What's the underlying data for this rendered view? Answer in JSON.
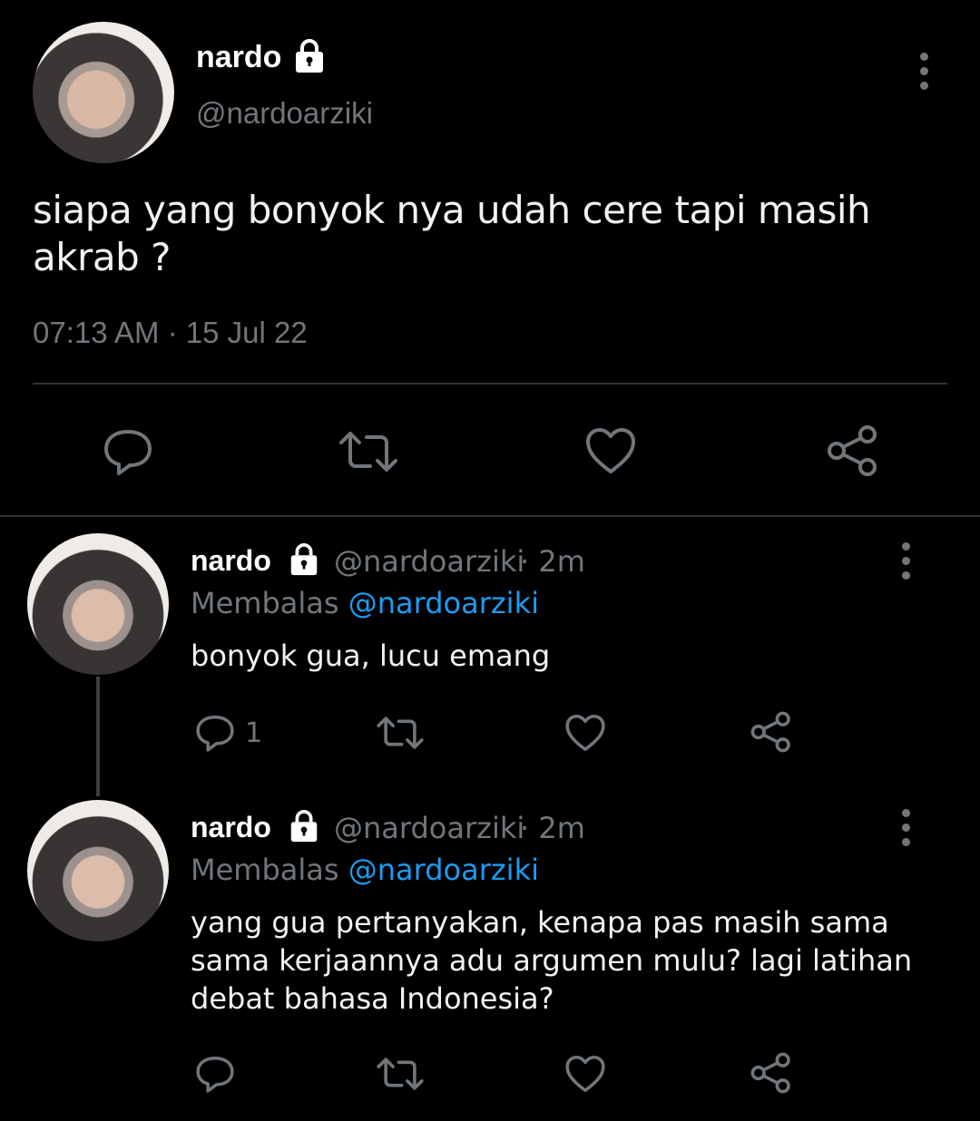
{
  "main_tweet": {
    "name": "nardo",
    "handle": "@nardoarziki",
    "text": "siapa yang bonyok nya udah cere tapi masih akrab ?",
    "timestamp": "07:13 AM · 15 Jul 22",
    "protected_icon": "lock-icon",
    "action_icons": [
      "reply-icon",
      "retweet-icon",
      "like-icon",
      "share-icon"
    ]
  },
  "replies": [
    {
      "name": "nardo",
      "handle": "@nardoarziki",
      "time_ago": "· 2m",
      "replying_label": "Membalas",
      "replying_to": "@nardoarziki",
      "text": "bonyok gua, lucu emang",
      "reply_count": "1"
    },
    {
      "name": "nardo",
      "handle": "@nardoarziki",
      "time_ago": "· 2m",
      "replying_label": "Membalas",
      "replying_to": "@nardoarziki",
      "text": "yang gua pertanyakan, kenapa pas masih sama sama kerjaannya adu argumen mulu? lagi latihan debat bahasa Indonesia?",
      "reply_count": ""
    }
  ],
  "colors": {
    "background": "#000000",
    "secondary_text": "#71767b",
    "mention": "#1d9bf0",
    "divider": "#2f3336"
  }
}
